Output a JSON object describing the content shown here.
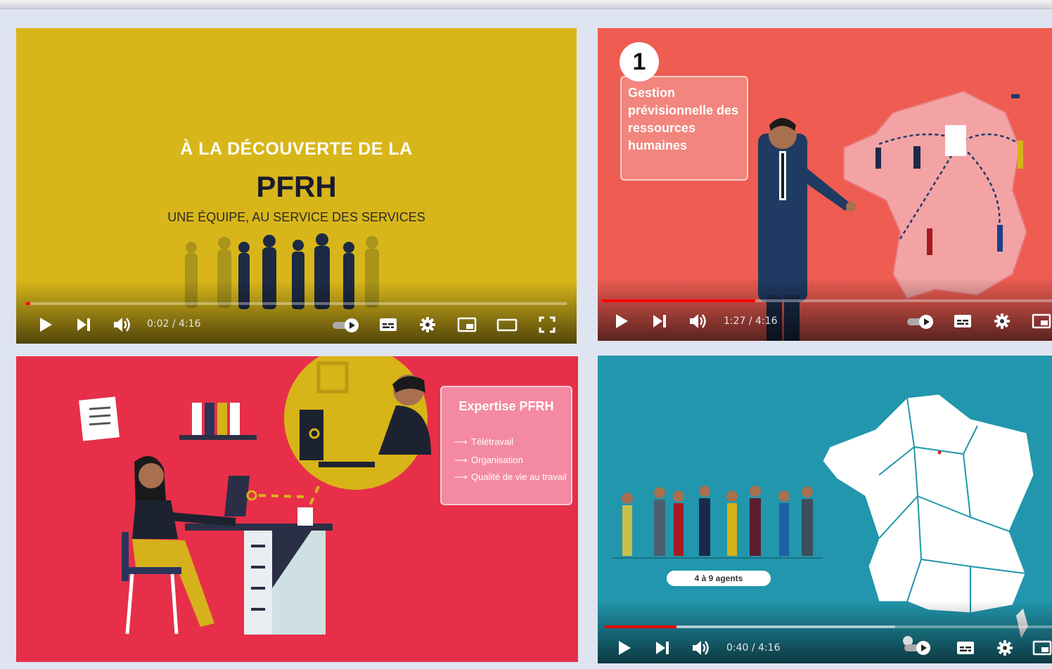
{
  "videos": [
    {
      "title_pre": "À LA DÉCOUVERTE DE LA",
      "title": "PFRH",
      "subtitle": "UNE ÉQUIPE, AU SERVICE DES SERVICES",
      "time": "0:02 / 4:16",
      "progress": 0.008
    },
    {
      "step": "1",
      "card_text": "Gestion prévisionnelle des ressources humaines",
      "time": "1:27 / 4:16",
      "progress": 0.34
    },
    {
      "card_title": "Expertise PFRH",
      "items": [
        "Télétravail",
        "Organisation",
        "Qualité de vie au travail"
      ]
    },
    {
      "pill_text": "4 à 9 agents",
      "time": "0:40 / 4:16",
      "progress": 0.16
    }
  ],
  "colors": {
    "video1_bg": "#d8b61a",
    "video2_bg": "#ee5c52",
    "video3_bg": "#e72f49",
    "video4_bg": "#2196ac",
    "progress": "#ff0000"
  },
  "icons": [
    "play-icon",
    "next-icon",
    "volume-icon",
    "autoplay-toggle-icon",
    "captions-icon",
    "settings-icon",
    "miniplayer-icon",
    "theater-icon",
    "fullscreen-icon"
  ]
}
